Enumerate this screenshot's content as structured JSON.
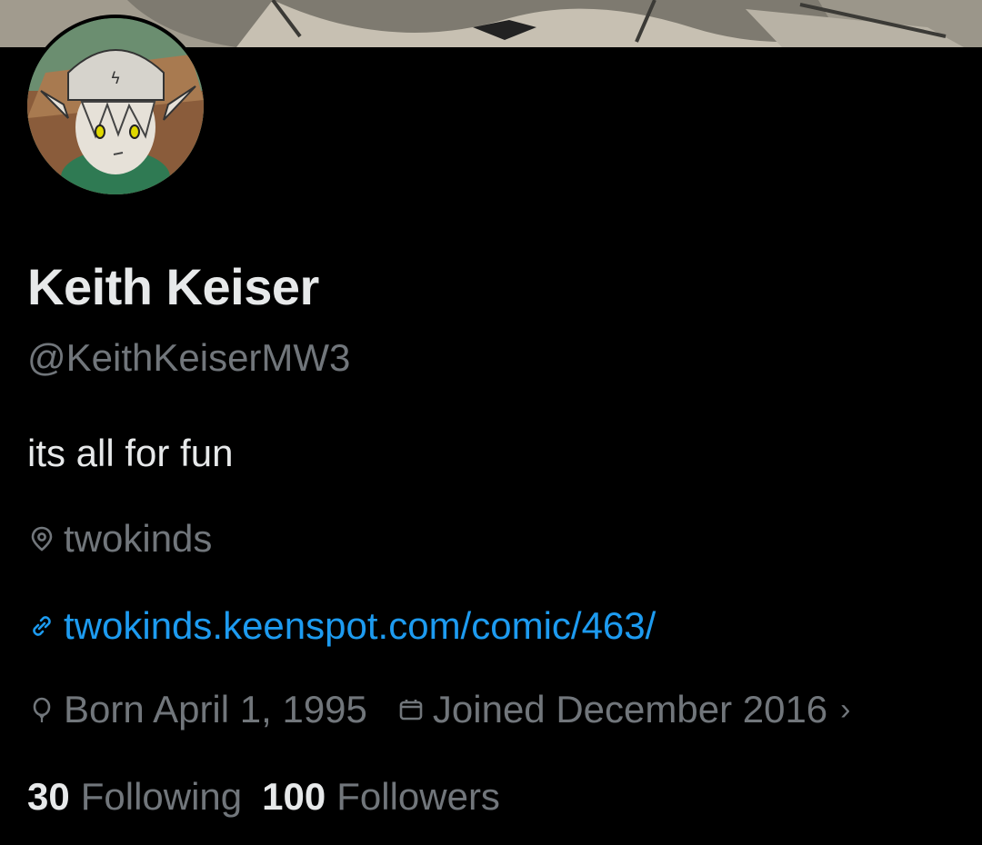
{
  "profile": {
    "name": "Keith Keiser",
    "handle": "@KeithKeiserMW3",
    "bio": "its all for fun",
    "location": "twokinds",
    "link": "twokinds.keenspot.com/comic/463/",
    "born": "Born April 1, 1995",
    "joined": "Joined December 2016",
    "following_count": "30",
    "following_label": "Following",
    "followers_count": "100",
    "followers_label": "Followers"
  },
  "icons": {
    "location": "location-pin-icon",
    "link": "link-icon",
    "birthday": "balloon-icon",
    "joined": "calendar-icon",
    "chevron": "chevron-right-icon"
  },
  "colors": {
    "background": "#000000",
    "primary_text": "#e7e9ea",
    "secondary_text": "#71767b",
    "link": "#1d9bf0"
  }
}
